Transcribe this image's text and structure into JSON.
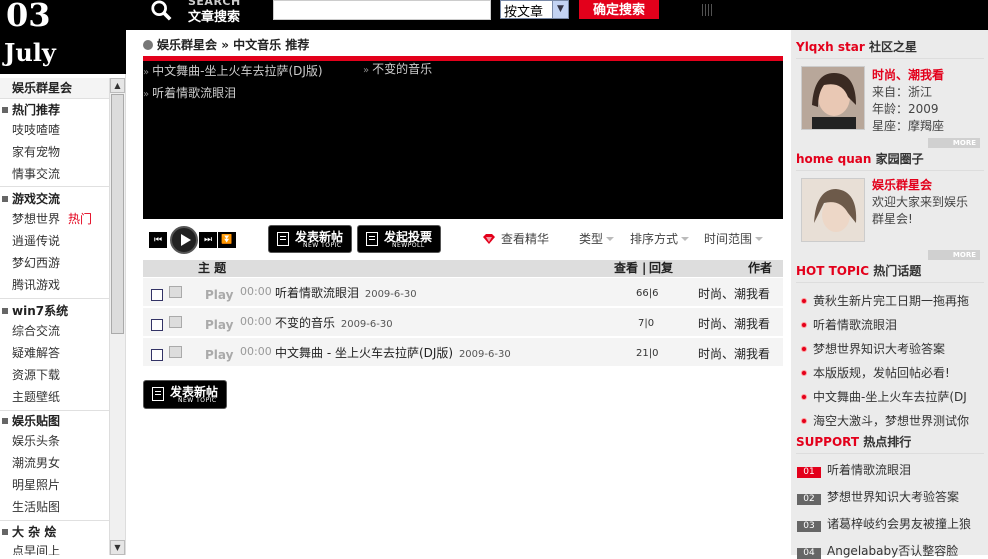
{
  "date": {
    "day": "03",
    "month": "July"
  },
  "search": {
    "brand_en": "SEARCH",
    "brand_cn": "文章搜索",
    "input_value": "",
    "select_value": "按文章",
    "submit_label": "确定搜索"
  },
  "left_nav": {
    "top": "娱乐群星会",
    "groups": [
      {
        "title": "热门推荐",
        "items": [
          "吱吱喳喳",
          "家有宠物",
          "情事交流"
        ]
      },
      {
        "title": "游戏交流",
        "items": [
          "梦想世界",
          "逍遥传说",
          "梦幻西游",
          "腾讯游戏"
        ],
        "hot": "热门"
      },
      {
        "title": "win7系统",
        "items": [
          "综合交流",
          "疑难解答",
          "资源下载",
          "主题壁纸"
        ]
      },
      {
        "title": "娱乐贴图",
        "items": [
          "娱乐头条",
          "潮流男女",
          "明星照片",
          "生活贴图"
        ]
      },
      {
        "title": "大 杂 烩",
        "items": [
          "点早间上"
        ]
      }
    ]
  },
  "breadcrumb": {
    "a": "娱乐群星会",
    "sep": "»",
    "b": "中文音乐",
    "c": "推荐"
  },
  "playlist": [
    "中文舞曲-坐上火车去拉萨(DJ版)",
    "不变的音乐",
    "听着情歌流眼泪"
  ],
  "toolbar": {
    "new_topic": "发表新帖",
    "new_topic_en": "NEW TOPIC",
    "new_poll": "发起投票",
    "new_poll_en": "NEWPOLL",
    "digest": "查看精华",
    "type": "类型",
    "sort": "排序方式",
    "range": "时间范围"
  },
  "table": {
    "headers": {
      "subject": "主  题",
      "views": "查看",
      "sep": "|",
      "replies": "回复",
      "author": "作者"
    },
    "rows": [
      {
        "play": "Play",
        "dur": "00:00",
        "title": "听着情歌流眼泪",
        "date": "2009-6-30",
        "stats": "66|6",
        "author": "时尚、潮我看"
      },
      {
        "play": "Play",
        "dur": "00:00",
        "title": "不变的音乐",
        "date": "2009-6-30",
        "stats": "7|0",
        "author": "时尚、潮我看"
      },
      {
        "play": "Play",
        "dur": "00:00",
        "title": "中文舞曲  - 坐上火车去拉萨(DJ版)",
        "date": "2009-6-30",
        "stats": "21|0",
        "author": "时尚、潮我看"
      }
    ]
  },
  "right": {
    "star": {
      "title_red": "Ylqxh star",
      "title_sub": "社区之星",
      "name": "时尚、潮我看",
      "from": "来自：浙江",
      "age": "年龄：2009",
      "sign": "星座：摩羯座",
      "more": "MORE"
    },
    "circle": {
      "title_red": "home quan",
      "title_sub": "家园圈子",
      "name": "娱乐群星会",
      "desc1": "欢迎大家来到娱乐",
      "desc2": "群星会!",
      "more": "MORE"
    },
    "hot": {
      "title_red": "HOT TOPIC",
      "title_sub": "热门话题",
      "items": [
        "黄秋生新片完工日期一拖再拖",
        "听着情歌流眼泪",
        "梦想世界知识大考验答案",
        "本版版规，发帖回帖必看!",
        "中文舞曲-坐上火车去拉萨(DJ",
        "海空大激斗，梦想世界测试你"
      ]
    },
    "support": {
      "title_red": "SUPPORT",
      "title_sub": "热点排行",
      "items": [
        {
          "n": "01",
          "t": "听着情歌流眼泪"
        },
        {
          "n": "02",
          "t": "梦想世界知识大考验答案"
        },
        {
          "n": "03",
          "t": "诸葛梓岐约会男友被撞上狼"
        },
        {
          "n": "04",
          "t": "Angelababy否认整容脸"
        }
      ]
    }
  }
}
